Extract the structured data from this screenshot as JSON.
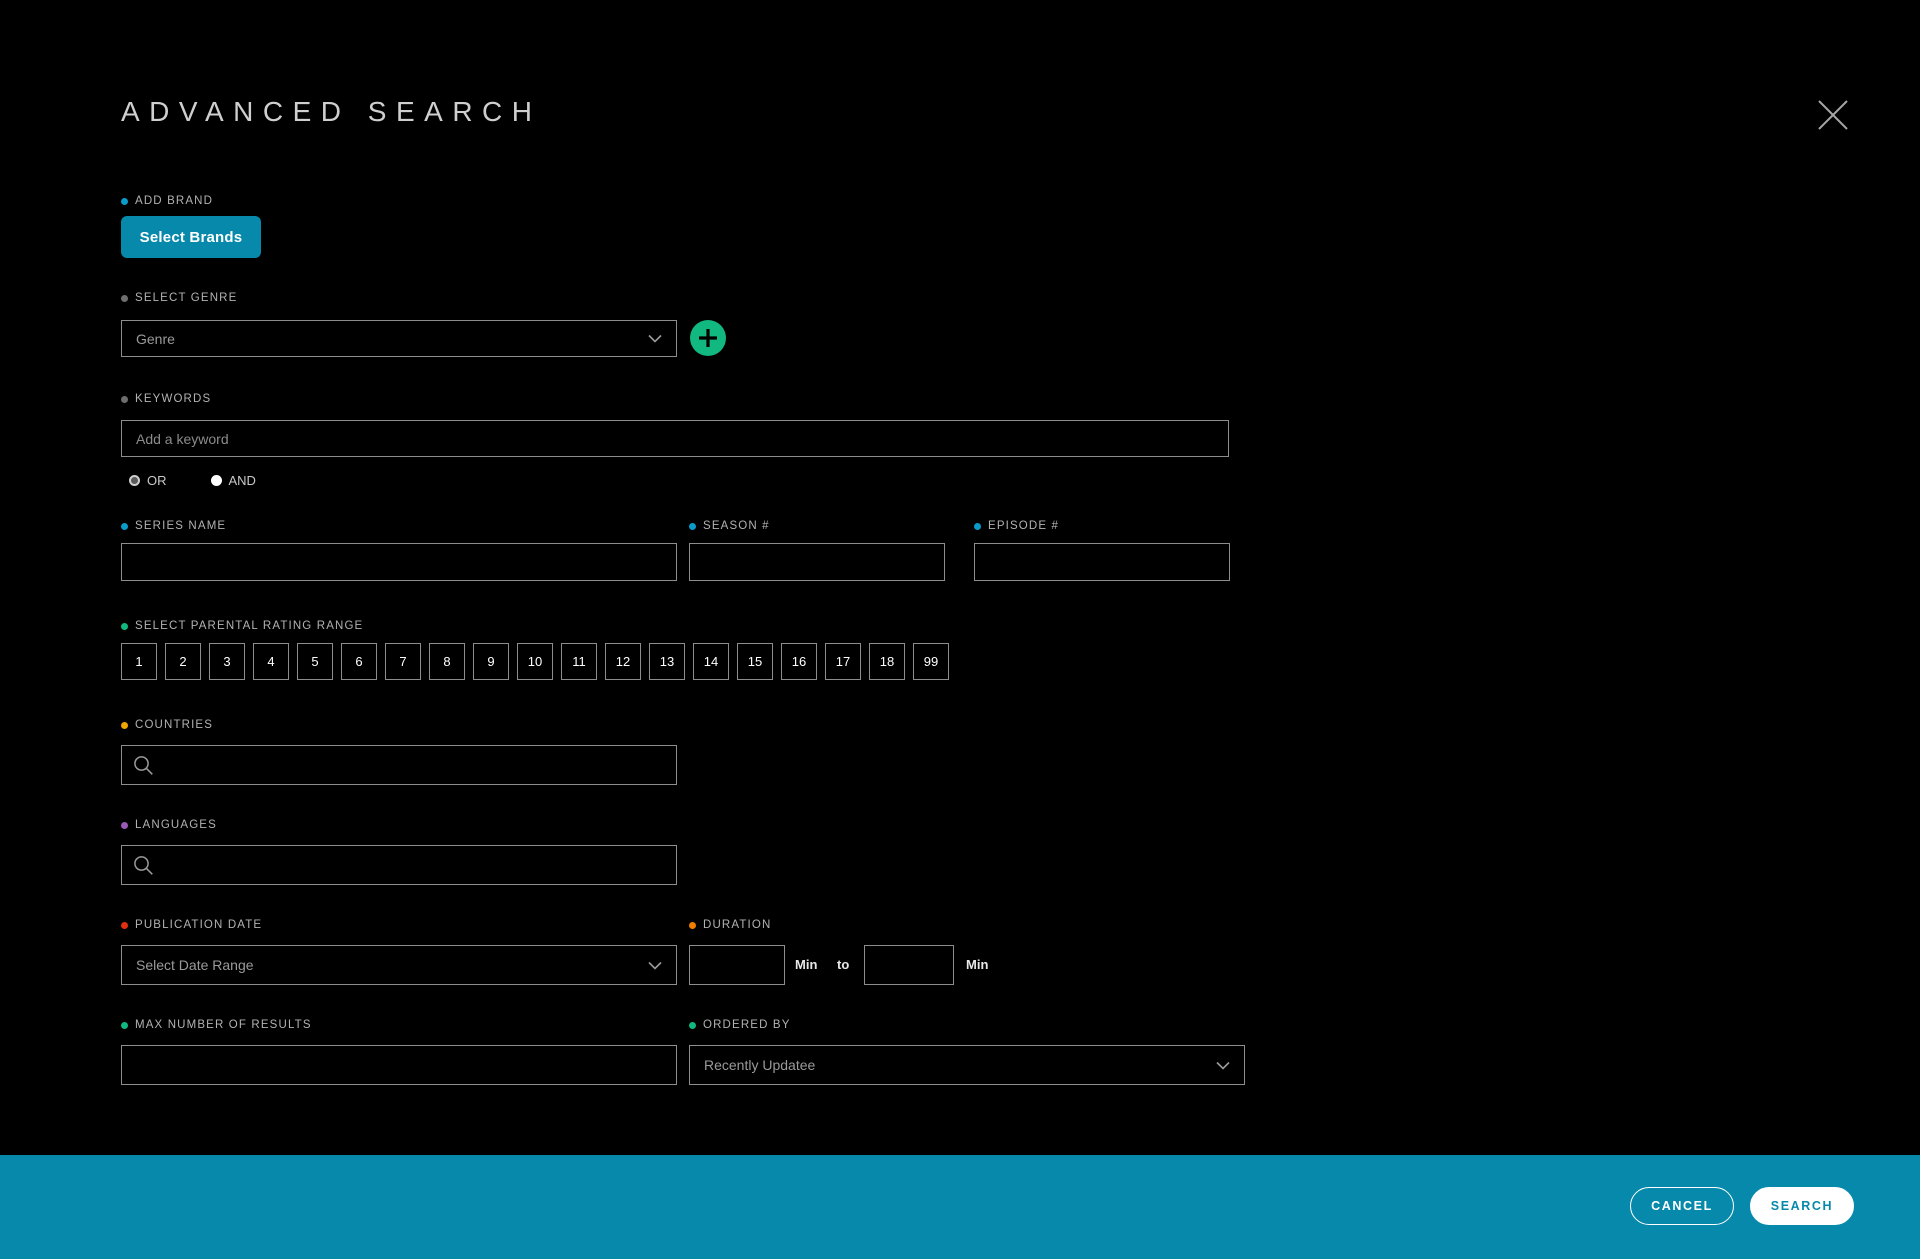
{
  "header": {
    "title": "ADVANCED SEARCH",
    "close_icon": "close-icon"
  },
  "colors": {
    "accent_teal": "#0789ab",
    "accent_green": "#11b880",
    "dot_blue": "#0a9bc9",
    "dot_grey": "#6e6e6e",
    "dot_green": "#11b880",
    "dot_orange": "#f0a500",
    "dot_purple": "#9b59b6",
    "dot_red": "#e03010",
    "dot_orange2": "#f07d00",
    "background": "#000000",
    "border": "#8d8d8d"
  },
  "form": {
    "add_brand": {
      "label": "ADD BRAND",
      "dot_color": "#0a9bc9",
      "button_label": "Select Brands"
    },
    "select_genre": {
      "label": "SELECT GENRE",
      "dot_color": "#6e6e6e",
      "value": "Genre",
      "add_icon": "plus-icon"
    },
    "keywords": {
      "label": "KEYWORDS",
      "dot_color": "#6e6e6e",
      "placeholder": "Add a keyword",
      "value": "",
      "operators": [
        {
          "label": "OR",
          "selected": true
        },
        {
          "label": "AND",
          "selected": false
        }
      ]
    },
    "series_name": {
      "label": "SERIES NAME",
      "dot_color": "#0a9bc9",
      "value": "",
      "placeholder": ""
    },
    "season_number": {
      "label": "SEASON #",
      "dot_color": "#0a9bc9",
      "value": "",
      "placeholder": ""
    },
    "episode_number": {
      "label": "EPISODE #",
      "dot_color": "#0a9bc9",
      "value": "",
      "placeholder": ""
    },
    "parental_rating": {
      "label": "SELECT PARENTAL RATING RANGE",
      "dot_color": "#11b880",
      "options": [
        "1",
        "2",
        "3",
        "4",
        "5",
        "6",
        "7",
        "8",
        "9",
        "10",
        "11",
        "12",
        "13",
        "14",
        "15",
        "16",
        "17",
        "18",
        "99"
      ]
    },
    "countries": {
      "label": "COUNTRIES",
      "dot_color": "#f0a500",
      "icon": "search-icon",
      "value": "",
      "placeholder": ""
    },
    "languages": {
      "label": "LANGUAGES",
      "dot_color": "#9b59b6",
      "icon": "search-icon",
      "value": "",
      "placeholder": ""
    },
    "publication_date": {
      "label": "PUBLICATION DATE",
      "dot_color": "#e03010",
      "value": "Select Date Range"
    },
    "duration": {
      "label": "DURATION",
      "dot_color": "#f07d00",
      "min_value": "",
      "max_value": "",
      "unit_from": "Min",
      "separator": "to",
      "unit_to": "Min"
    },
    "max_results": {
      "label": "MAX NUMBER OF RESULTS",
      "dot_color": "#11b880",
      "value": "",
      "placeholder": ""
    },
    "ordered_by": {
      "label": "ORDERED BY",
      "dot_color": "#11b880",
      "value": "Recently Updatee"
    }
  },
  "footer": {
    "cancel_label": "CANCEL",
    "search_label": "SEARCH"
  }
}
